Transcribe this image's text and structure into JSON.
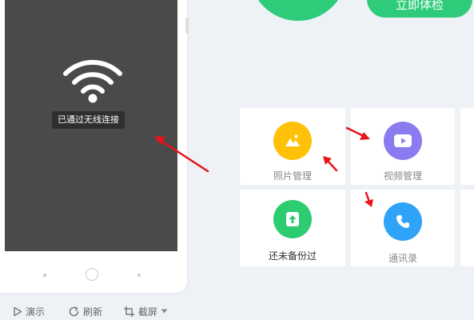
{
  "phone": {
    "wifi_status": "已通过无线连接"
  },
  "toolbar": {
    "demo_label": "演示",
    "refresh_label": "刷新",
    "screenshot_label": "截屏"
  },
  "top": {
    "trial_button_label": "立即体检"
  },
  "features": [
    {
      "label": "照片管理",
      "icon": "photo-icon",
      "color": "#ffc107"
    },
    {
      "label": "视频管理",
      "icon": "video-icon",
      "color": "#8a7bf0"
    },
    {
      "label": "还未备份过",
      "icon": "backup-upload-icon",
      "color": "#2ecc71"
    },
    {
      "label": "通讯录",
      "icon": "phone-icon",
      "color": "#2fa3f7"
    }
  ],
  "colors": {
    "accent_green": "#2ecc7a",
    "annotation_arrow": "#e8131b",
    "screen_bg": "#4a4a4a",
    "page_bg": "#eef2f6"
  }
}
